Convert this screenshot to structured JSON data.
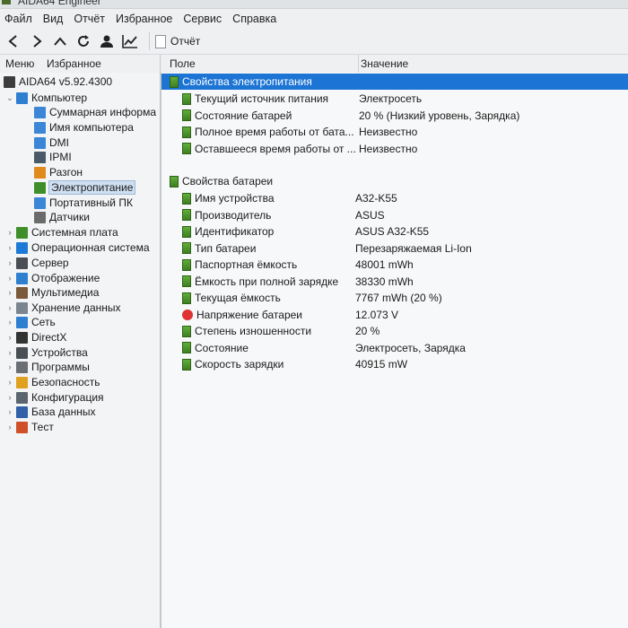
{
  "window": {
    "title": "AIDA64 Engineer"
  },
  "menu": [
    "Файл",
    "Вид",
    "Отчёт",
    "Избранное",
    "Сервис",
    "Справка"
  ],
  "toolbar": {
    "icons": [
      "back-icon",
      "forward-icon",
      "up-icon",
      "refresh-icon",
      "user-icon",
      "chart-icon"
    ],
    "report_label": "Отчёт"
  },
  "left_tabs": [
    "Меню",
    "Избранное"
  ],
  "columns": {
    "field": "Поле",
    "value": "Значение"
  },
  "tree": [
    {
      "label": "AIDA64 v5.92.4300",
      "level": 0,
      "icon": "aida64-icon",
      "color": "#3d3d3d"
    },
    {
      "label": "Компьютер",
      "level": 1,
      "icon": "computer-icon",
      "expanded": true,
      "color": "#2f7fd1"
    },
    {
      "label": "Суммарная информа",
      "level": 2,
      "icon": "summary-icon",
      "color": "#3b86d6"
    },
    {
      "label": "Имя компьютера",
      "level": 2,
      "icon": "computer-name-icon",
      "color": "#3b86d6"
    },
    {
      "label": "DMI",
      "level": 2,
      "icon": "dmi-icon",
      "color": "#3b86d6"
    },
    {
      "label": "IPMI",
      "level": 2,
      "icon": "ipmi-icon",
      "color": "#4b5a68"
    },
    {
      "label": "Разгон",
      "level": 2,
      "icon": "overclock-icon",
      "color": "#e08a1e"
    },
    {
      "label": "Электропитание",
      "level": 2,
      "icon": "power-icon",
      "selected": true,
      "color": "#3e8f2a"
    },
    {
      "label": "Портативный ПК",
      "level": 2,
      "icon": "portable-pc-icon",
      "color": "#3b86d6"
    },
    {
      "label": "Датчики",
      "level": 2,
      "icon": "sensors-icon",
      "color": "#6b6b6b"
    },
    {
      "label": "Системная плата",
      "level": 1,
      "icon": "motherboard-icon",
      "color": "#3e8f2a"
    },
    {
      "label": "Операционная система",
      "level": 1,
      "icon": "windows-icon",
      "color": "#1d7ad6"
    },
    {
      "label": "Сервер",
      "level": 1,
      "icon": "server-icon",
      "color": "#4a4f55"
    },
    {
      "label": "Отображение",
      "level": 1,
      "icon": "display-icon",
      "color": "#2f7fd1"
    },
    {
      "label": "Мультимедиа",
      "level": 1,
      "icon": "multimedia-icon",
      "color": "#7a5a3a"
    },
    {
      "label": "Хранение данных",
      "level": 1,
      "icon": "storage-icon",
      "color": "#7b8590"
    },
    {
      "label": "Сеть",
      "level": 1,
      "icon": "network-icon",
      "color": "#2f7fd1"
    },
    {
      "label": "DirectX",
      "level": 1,
      "icon": "directx-icon",
      "color": "#333333"
    },
    {
      "label": "Устройства",
      "level": 1,
      "icon": "devices-icon",
      "color": "#4a4f55"
    },
    {
      "label": "Программы",
      "level": 1,
      "icon": "programs-icon",
      "color": "#6a6f74"
    },
    {
      "label": "Безопасность",
      "level": 1,
      "icon": "security-icon",
      "color": "#e0a020"
    },
    {
      "label": "Конфигурация",
      "level": 1,
      "icon": "config-icon",
      "color": "#5b6570"
    },
    {
      "label": "База данных",
      "level": 1,
      "icon": "database-icon",
      "color": "#3060a8"
    },
    {
      "label": "Тест",
      "level": 1,
      "icon": "test-icon",
      "color": "#d0502a"
    }
  ],
  "sections": [
    {
      "title": "Свойства электропитания",
      "highlighted": true,
      "rows": [
        {
          "field": "Текущий источник питания",
          "value": "Электросеть"
        },
        {
          "field": "Состояние батарей",
          "value": "20 % (Низкий уровень, Зарядка)"
        },
        {
          "field": "Полное время работы от бата...",
          "value": "Неизвестно"
        },
        {
          "field": "Оставшееся время работы от ...",
          "value": "Неизвестно"
        }
      ]
    },
    {
      "title": "Свойства батареи",
      "highlighted": false,
      "rows": [
        {
          "field": "Имя устройства",
          "value": "A32-K55"
        },
        {
          "field": "Производитель",
          "value": "ASUS"
        },
        {
          "field": "Идентификатор",
          "value": "ASUS A32-K55"
        },
        {
          "field": "Тип батареи",
          "value": "Перезаряжаемая Li-Ion"
        },
        {
          "field": "Паспортная ёмкость",
          "value": "48001 mWh"
        },
        {
          "field": "Ёмкость при полной зарядке",
          "value": "38330 mWh"
        },
        {
          "field": "Текущая ёмкость",
          "value": "7767 mWh  (20 %)"
        },
        {
          "field": "Напряжение батареи",
          "value": "12.073 V",
          "icon": "voltage-icon"
        },
        {
          "field": "Степень изношенности",
          "value": "20 %"
        },
        {
          "field": "Состояние",
          "value": "Электросеть, Зарядка"
        },
        {
          "field": "Скорость зарядки",
          "value": "40915 mW"
        }
      ]
    }
  ]
}
